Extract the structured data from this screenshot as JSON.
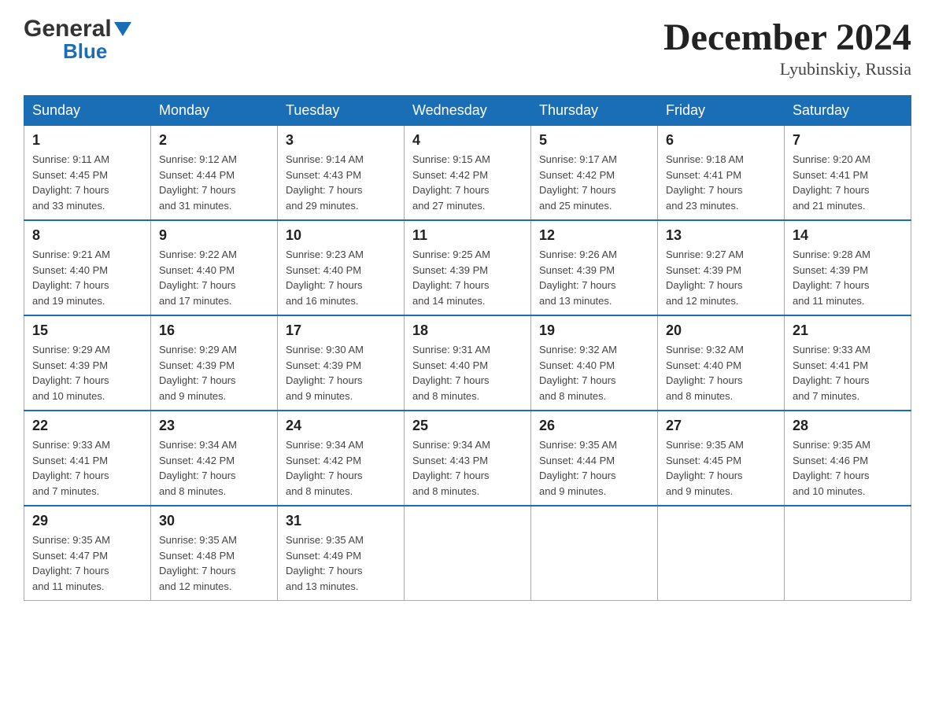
{
  "header": {
    "logo_general": "General",
    "logo_blue": "Blue",
    "month_title": "December 2024",
    "location": "Lyubinskiy, Russia"
  },
  "days_of_week": [
    "Sunday",
    "Monday",
    "Tuesday",
    "Wednesday",
    "Thursday",
    "Friday",
    "Saturday"
  ],
  "weeks": [
    [
      {
        "day": "1",
        "sunrise": "9:11 AM",
        "sunset": "4:45 PM",
        "daylight": "7 hours and 33 minutes."
      },
      {
        "day": "2",
        "sunrise": "9:12 AM",
        "sunset": "4:44 PM",
        "daylight": "7 hours and 31 minutes."
      },
      {
        "day": "3",
        "sunrise": "9:14 AM",
        "sunset": "4:43 PM",
        "daylight": "7 hours and 29 minutes."
      },
      {
        "day": "4",
        "sunrise": "9:15 AM",
        "sunset": "4:42 PM",
        "daylight": "7 hours and 27 minutes."
      },
      {
        "day": "5",
        "sunrise": "9:17 AM",
        "sunset": "4:42 PM",
        "daylight": "7 hours and 25 minutes."
      },
      {
        "day": "6",
        "sunrise": "9:18 AM",
        "sunset": "4:41 PM",
        "daylight": "7 hours and 23 minutes."
      },
      {
        "day": "7",
        "sunrise": "9:20 AM",
        "sunset": "4:41 PM",
        "daylight": "7 hours and 21 minutes."
      }
    ],
    [
      {
        "day": "8",
        "sunrise": "9:21 AM",
        "sunset": "4:40 PM",
        "daylight": "7 hours and 19 minutes."
      },
      {
        "day": "9",
        "sunrise": "9:22 AM",
        "sunset": "4:40 PM",
        "daylight": "7 hours and 17 minutes."
      },
      {
        "day": "10",
        "sunrise": "9:23 AM",
        "sunset": "4:40 PM",
        "daylight": "7 hours and 16 minutes."
      },
      {
        "day": "11",
        "sunrise": "9:25 AM",
        "sunset": "4:39 PM",
        "daylight": "7 hours and 14 minutes."
      },
      {
        "day": "12",
        "sunrise": "9:26 AM",
        "sunset": "4:39 PM",
        "daylight": "7 hours and 13 minutes."
      },
      {
        "day": "13",
        "sunrise": "9:27 AM",
        "sunset": "4:39 PM",
        "daylight": "7 hours and 12 minutes."
      },
      {
        "day": "14",
        "sunrise": "9:28 AM",
        "sunset": "4:39 PM",
        "daylight": "7 hours and 11 minutes."
      }
    ],
    [
      {
        "day": "15",
        "sunrise": "9:29 AM",
        "sunset": "4:39 PM",
        "daylight": "7 hours and 10 minutes."
      },
      {
        "day": "16",
        "sunrise": "9:29 AM",
        "sunset": "4:39 PM",
        "daylight": "7 hours and 9 minutes."
      },
      {
        "day": "17",
        "sunrise": "9:30 AM",
        "sunset": "4:39 PM",
        "daylight": "7 hours and 9 minutes."
      },
      {
        "day": "18",
        "sunrise": "9:31 AM",
        "sunset": "4:40 PM",
        "daylight": "7 hours and 8 minutes."
      },
      {
        "day": "19",
        "sunrise": "9:32 AM",
        "sunset": "4:40 PM",
        "daylight": "7 hours and 8 minutes."
      },
      {
        "day": "20",
        "sunrise": "9:32 AM",
        "sunset": "4:40 PM",
        "daylight": "7 hours and 8 minutes."
      },
      {
        "day": "21",
        "sunrise": "9:33 AM",
        "sunset": "4:41 PM",
        "daylight": "7 hours and 7 minutes."
      }
    ],
    [
      {
        "day": "22",
        "sunrise": "9:33 AM",
        "sunset": "4:41 PM",
        "daylight": "7 hours and 7 minutes."
      },
      {
        "day": "23",
        "sunrise": "9:34 AM",
        "sunset": "4:42 PM",
        "daylight": "7 hours and 8 minutes."
      },
      {
        "day": "24",
        "sunrise": "9:34 AM",
        "sunset": "4:42 PM",
        "daylight": "7 hours and 8 minutes."
      },
      {
        "day": "25",
        "sunrise": "9:34 AM",
        "sunset": "4:43 PM",
        "daylight": "7 hours and 8 minutes."
      },
      {
        "day": "26",
        "sunrise": "9:35 AM",
        "sunset": "4:44 PM",
        "daylight": "7 hours and 9 minutes."
      },
      {
        "day": "27",
        "sunrise": "9:35 AM",
        "sunset": "4:45 PM",
        "daylight": "7 hours and 9 minutes."
      },
      {
        "day": "28",
        "sunrise": "9:35 AM",
        "sunset": "4:46 PM",
        "daylight": "7 hours and 10 minutes."
      }
    ],
    [
      {
        "day": "29",
        "sunrise": "9:35 AM",
        "sunset": "4:47 PM",
        "daylight": "7 hours and 11 minutes."
      },
      {
        "day": "30",
        "sunrise": "9:35 AM",
        "sunset": "4:48 PM",
        "daylight": "7 hours and 12 minutes."
      },
      {
        "day": "31",
        "sunrise": "9:35 AM",
        "sunset": "4:49 PM",
        "daylight": "7 hours and 13 minutes."
      },
      null,
      null,
      null,
      null
    ]
  ],
  "labels": {
    "sunrise": "Sunrise:",
    "sunset": "Sunset:",
    "daylight": "Daylight:"
  }
}
